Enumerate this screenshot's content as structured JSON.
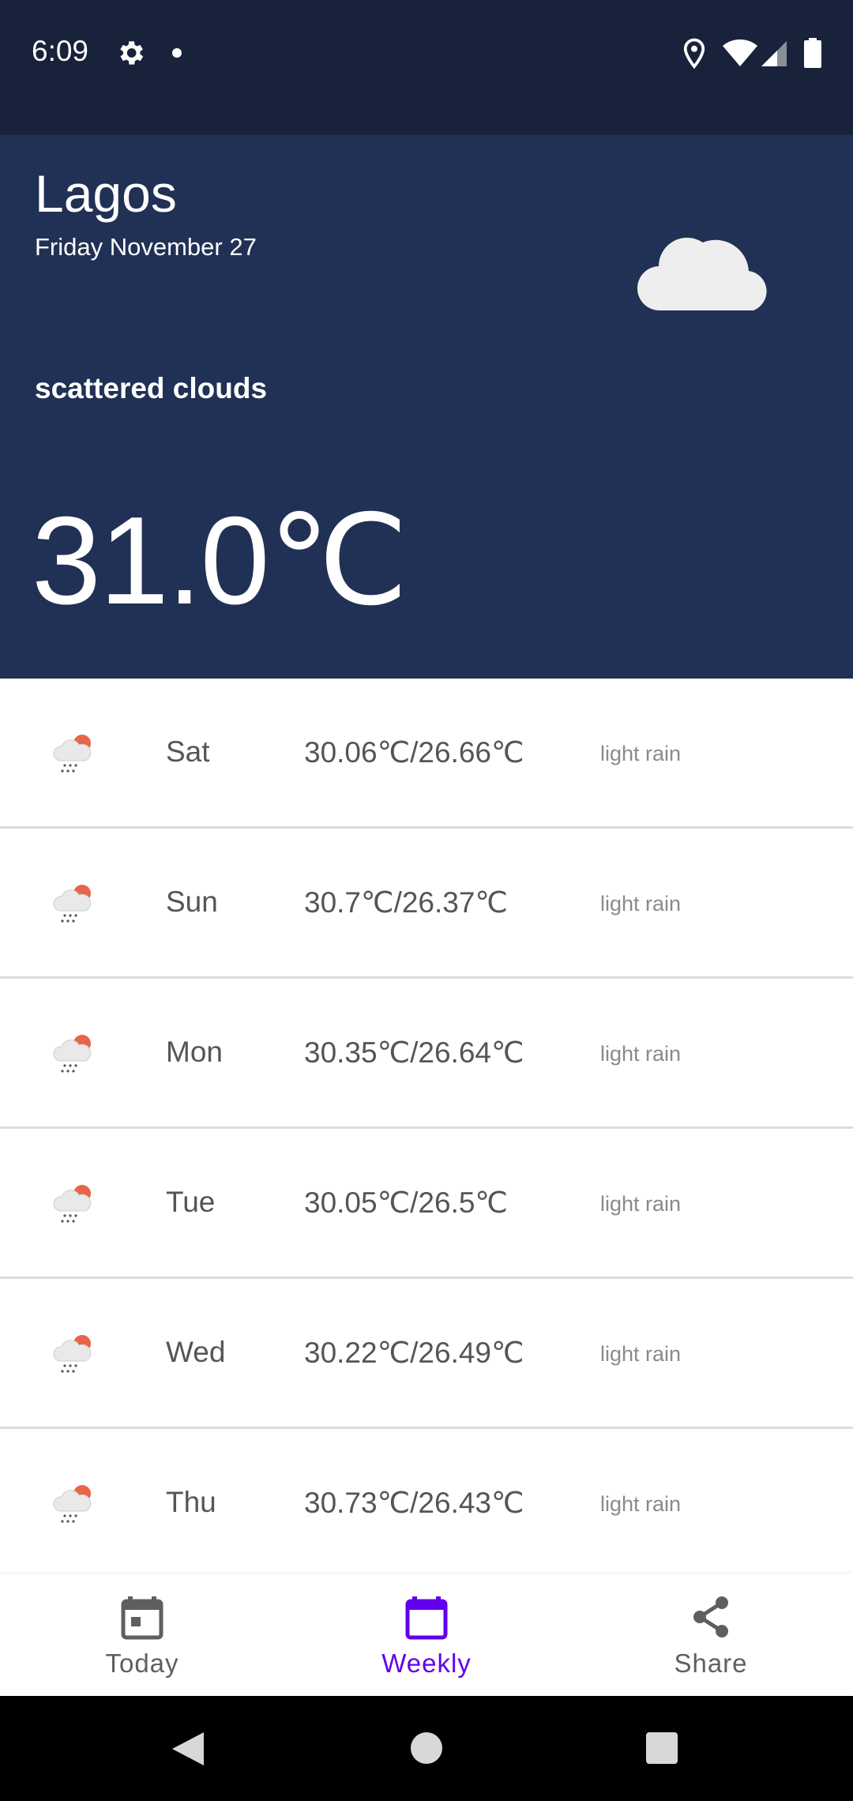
{
  "status_bar": {
    "time": "6:09",
    "icons": [
      "gear-icon",
      "notification-dot-icon",
      "location-icon",
      "wifi-icon",
      "signal-icon",
      "battery-icon"
    ]
  },
  "current": {
    "city": "Lagos",
    "date": "Friday November 27",
    "description": "scattered clouds",
    "temperature": "31.0℃",
    "icon": "cloud-icon"
  },
  "forecast": [
    {
      "day": "Sat",
      "temp": "30.06℃/26.66℃",
      "desc": "light rain",
      "icon": "rain-sun-icon"
    },
    {
      "day": "Sun",
      "temp": "30.7℃/26.37℃",
      "desc": "light rain",
      "icon": "rain-sun-icon"
    },
    {
      "day": "Mon",
      "temp": "30.35℃/26.64℃",
      "desc": "light rain",
      "icon": "rain-sun-icon"
    },
    {
      "day": "Tue",
      "temp": "30.05℃/26.5℃",
      "desc": "light rain",
      "icon": "rain-sun-icon"
    },
    {
      "day": "Wed",
      "temp": "30.22℃/26.49℃",
      "desc": "light rain",
      "icon": "rain-sun-icon"
    },
    {
      "day": "Thu",
      "temp": "30.73℃/26.43℃",
      "desc": "light rain",
      "icon": "rain-sun-icon"
    }
  ],
  "bottom_nav": {
    "items": [
      {
        "label": "Today",
        "icon": "calendar-today-icon",
        "active": false
      },
      {
        "label": "Weekly",
        "icon": "calendar-icon",
        "active": true
      },
      {
        "label": "Share",
        "icon": "share-icon",
        "active": false
      }
    ]
  },
  "colors": {
    "status_bar": "#18223a",
    "header": "#213155",
    "accent": "#6200ee",
    "text_secondary": "#555555"
  }
}
